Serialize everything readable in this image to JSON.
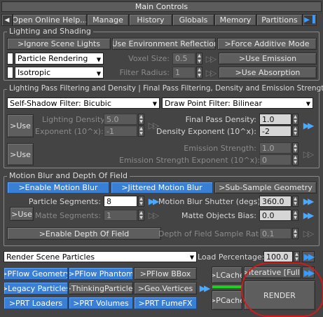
{
  "title": "Main Controls",
  "tabs": [
    "Open Online Help...",
    "Manage",
    "History",
    "Globals",
    "Memory",
    "Partitions"
  ],
  "lighting": {
    "group_title": "Lighting and Shading",
    "ignore_scene_lights": ">Ignore Scene Lights",
    "use_env_reflections": ">Use Environment Reflections",
    "force_additive": ">Force Additive Mode",
    "render_mode": "Particle Rendering",
    "voxel_size_label": "Voxel Size:",
    "voxel_size_value": "0.5",
    "use_emission": ">Use Emission",
    "phase_function": "Isotropic",
    "filter_radius_label": "Filter Radius:",
    "filter_radius_value": "1",
    "use_absorption": ">Use Absorption"
  },
  "pass": {
    "group_title": "Lighting Pass Filtering and Density | Final Pass Filtering, Density and Emission Strength",
    "self_shadow_filter": "Self-Shadow Filter: Bicubic",
    "draw_point_filter": "Draw Point Filter: Bilinear",
    "use_label": ">Use",
    "lighting_density_label": "Lighting Density:",
    "lighting_density_value": "5.0",
    "exponent_label": "Exponent (10^x):",
    "exponent_value": "-1",
    "final_density_label": "Final Pass Density:",
    "final_density_value": "1.0",
    "density_exponent_label": "Density Exponent (10^x):",
    "density_exponent_value": "-2",
    "use_label_2": ">Use",
    "emission_strength_label": "Emission Strength:",
    "emission_strength_value": "1.0",
    "emission_exponent_label": "Emission Strength Exponent (10^x):",
    "emission_exponent_value": "0"
  },
  "motion": {
    "group_title": "Motion Blur and Depth Of Field",
    "enable_motion_blur": ">Enable Motion Blur",
    "jittered_motion_blur": ">Jittered Motion Blur",
    "sub_sample_geometry": ">Sub-Sample Geometry",
    "particle_segments_label": "Particle Segments:",
    "particle_segments_value": "8",
    "shutter_label": "Motion Blur Shutter (degs):",
    "shutter_value": "360.0",
    "use_label": ">Use",
    "matte_segments_label": "Matte Segments:",
    "matte_segments_value": "1",
    "matte_bias_label": "Matte Objects Bias:",
    "matte_bias_value": "0.0",
    "enable_dof": ">Enable Depth Of Field",
    "dof_rate_label": "Depth of Field Sample Rate:",
    "dof_rate_value": "0.1"
  },
  "bottom": {
    "render_mode": "Render Scene Particles",
    "load_percentage_label": "Load Percentage:",
    "load_percentage_value": "100.0",
    "pflow_geometry": ">PFlow Geometry",
    "pflow_phantom": ">PFlow Phantom",
    "pflow_bbox": ">PFlow BBox",
    "legacy_particles": ">Legacy Particles",
    "thinking_particles": ">ThinkingParticles",
    "geo_vertices": ">Geo.Vertices",
    "prt_loaders": ">PRT Loaders",
    "prt_volumes": ">PRT Volumes",
    "prt_fumefx": ">PRT FumeFX",
    "lcache": ">LCache",
    "pcache": ">PCache",
    "iterative": ">Iterative [Full]",
    "render": "RENDER"
  },
  "colors": {
    "accent_blue": "#3a7fd6",
    "progress_green": "#1ad21a",
    "highlight_red": "#d11a1a"
  }
}
